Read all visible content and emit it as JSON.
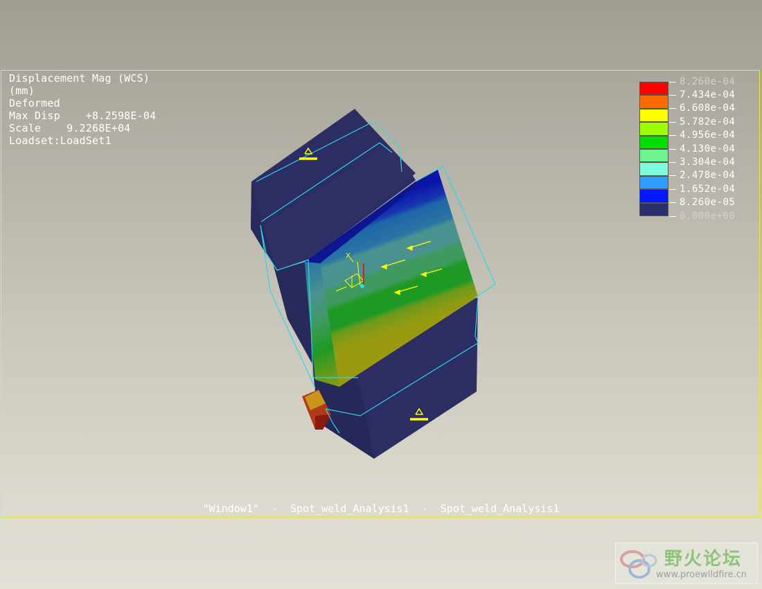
{
  "results_info": {
    "quantity": "Displacement Mag (WCS)",
    "units": "(mm)",
    "state": "Deformed",
    "max_disp_label": "Max Disp",
    "max_disp_value": "+8.2598E-04",
    "scale_label": "Scale",
    "scale_value": "9.2268E+04",
    "loadset": "Loadset:LoadSet1"
  },
  "legend": {
    "labels": [
      "8.260e-04",
      "7.434e-04",
      "6.608e-04",
      "5.782e-04",
      "4.956e-04",
      "4.130e-04",
      "3.304e-04",
      "2.478e-04",
      "1.652e-04",
      "8.260e-05",
      "0.000e+00"
    ],
    "colors": [
      "#ff0000",
      "#ff6a00",
      "#ffff00",
      "#9cff00",
      "#00e000",
      "#6cf58c",
      "#7cfcdc",
      "#2d9cff",
      "#0018ff",
      "#2a2f6c"
    ]
  },
  "window_caption": "\"Window1\"  -  Spot_weld_Analysis1  -  Spot_weld_Analysis1",
  "watermark": {
    "title": "野火论坛",
    "url": "www.proewildfire.cn"
  },
  "colors": {
    "viewport_border": "#e9e635",
    "model_base": "#2c2d62",
    "mesh_outline": "#2fd6e6",
    "constraint_marker": "#ffff00"
  }
}
